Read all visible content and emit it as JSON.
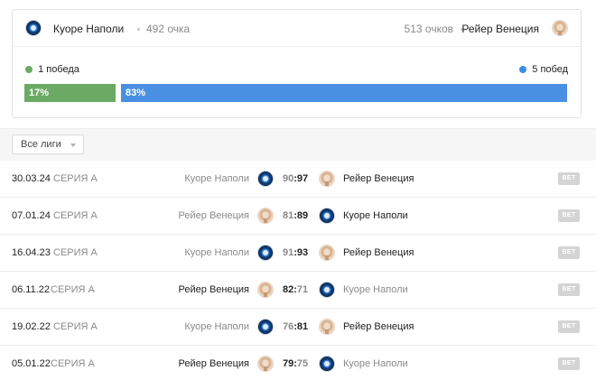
{
  "summary": {
    "home_team": "Куоре Наполи",
    "home_points": "492 очка",
    "away_points": "513 очков",
    "away_team": "Рейер Венеция",
    "home_wins_label": "1 победа",
    "away_wins_label": "5 побед",
    "home_percent_label": "17%",
    "away_percent_label": "83%",
    "home_share": 0.17,
    "away_share": 0.83,
    "home_color": "#6aaa64",
    "away_color": "#4a90e2"
  },
  "filter": {
    "league_select_value": "Все лиги"
  },
  "matches": [
    {
      "date": "30.03.24",
      "league": "СЕРИЯ А",
      "home": "Куоре Наполи",
      "home_score": "90",
      "colon": ":",
      "away_score": "97",
      "away": "Рейер Венеция",
      "winner": "away",
      "bet": "BET"
    },
    {
      "date": "07.01.24",
      "league": "СЕРИЯ А",
      "home": "Рейер Венеция",
      "home_score": "81",
      "colon": ":",
      "away_score": "89",
      "away": "Куоре Наполи",
      "winner": "away",
      "bet": "BET"
    },
    {
      "date": "16.04.23",
      "league": "СЕРИЯ А",
      "home": "Куоре Наполи",
      "home_score": "91",
      "colon": ":",
      "away_score": "93",
      "away": "Рейер Венеция",
      "winner": "away",
      "bet": "BET"
    },
    {
      "date": "06.11.22",
      "league": "СЕРИЯ А",
      "home": "Рейер Венеция",
      "home_score": "82",
      "colon": ":",
      "away_score": "71",
      "away": "Куоре Наполи",
      "winner": "home",
      "bet": "BET"
    },
    {
      "date": "19.02.22",
      "league": "СЕРИЯ А",
      "home": "Куоре Наполи",
      "home_score": "76",
      "colon": ":",
      "away_score": "81",
      "away": "Рейер Венеция",
      "winner": "away",
      "bet": "BET"
    },
    {
      "date": "05.01.22",
      "league": "СЕРИЯ А",
      "home": "Рейер Венеция",
      "home_score": "79",
      "colon": ":",
      "away_score": "75",
      "away": "Куоре Наполи",
      "winner": "home",
      "bet": "BET"
    }
  ],
  "icons": {
    "napoli": "napoli-logo-icon",
    "venezia": "venezia-logo-icon",
    "dropdown": "chevron-down-icon"
  }
}
